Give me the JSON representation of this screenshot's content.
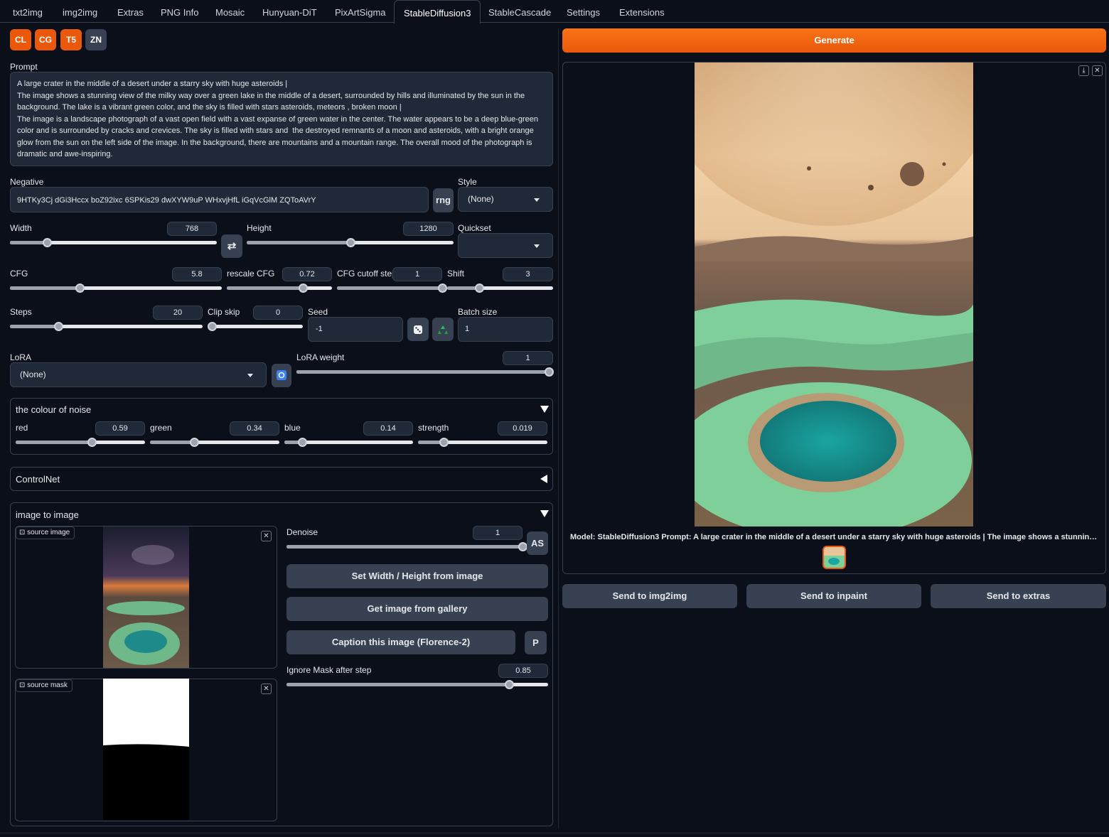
{
  "tabs": [
    "txt2img",
    "img2img",
    "Extras",
    "PNG Info",
    "Mosaic",
    "Hunyuan-DiT",
    "PixArtSigma",
    "StableDiffusion3",
    "StableCascade",
    "Settings",
    "Extensions"
  ],
  "toggles": [
    "CL",
    "CG",
    "T5",
    "ZN"
  ],
  "prompt": {
    "label": "Prompt",
    "value": "A large crater in the middle of a desert under a starry sky with huge asteroids |\nThe image shows a stunning view of the milky way over a green lake in the middle of a desert, surrounded by hills and illuminated by the sun in the\nbackground. The lake is a vibrant green color, and the sky is filled with stars asteroids, meteors , broken moon |\nThe image is a landscape photograph of a vast open field with a vast expanse of green water in the center. The water appears to be a deep blue-green\ncolor and is surrounded by cracks and crevices. The sky is filled with stars and  the destroyed remnants of a moon and asteroids, with a bright orange\nglow from the sun on the left side of the image. In the background, there are mountains and a mountain range. The overall mood of the photograph is\ndramatic and awe-inspiring."
  },
  "negative": {
    "label": "Negative",
    "value": "9HTKy3Cj dGi3Hccx boZ92ixc 6SPKis29 dwXYW9uP WHxvjHfL iGqVcGlM ZQToAVrY",
    "rng_label": "rng"
  },
  "style": {
    "label": "Style",
    "value": "(None)"
  },
  "width": {
    "label": "Width",
    "value": "768",
    "fraction": 0.18
  },
  "height": {
    "label": "Height",
    "value": "1280",
    "fraction": 0.5
  },
  "swap_icon": "⇄",
  "quickset": {
    "label": "Quickset",
    "value": ""
  },
  "cfg": {
    "label": "CFG",
    "value": "5.8",
    "fraction": 0.33
  },
  "rescale_cfg": {
    "label": "rescale CFG",
    "value": "0.72",
    "fraction": 0.72
  },
  "cfg_cutoff": {
    "label": "CFG cutoff step",
    "value": "1",
    "fraction": 1.0
  },
  "shift": {
    "label": "Shift",
    "value": "3",
    "fraction": 0.3
  },
  "steps": {
    "label": "Steps",
    "value": "20",
    "fraction": 0.25
  },
  "clip_skip": {
    "label": "Clip skip",
    "value": "0",
    "fraction": 0.0
  },
  "seed": {
    "label": "Seed",
    "value": "-1"
  },
  "batch_size": {
    "label": "Batch size",
    "value": "1"
  },
  "lora": {
    "label": "LoRA",
    "value": "(None)"
  },
  "lora_weight": {
    "label": "LoRA weight",
    "value": "1",
    "fraction": 1.0
  },
  "noise": {
    "title": "the colour of noise",
    "red": {
      "label": "red",
      "value": "0.59",
      "fraction": 0.59
    },
    "green": {
      "label": "green",
      "value": "0.34",
      "fraction": 0.34
    },
    "blue": {
      "label": "blue",
      "value": "0.14",
      "fraction": 0.14
    },
    "strength": {
      "label": "strength",
      "value": "0.019",
      "fraction": 0.2
    }
  },
  "controlnet": {
    "title": "ControlNet"
  },
  "i2i": {
    "title": "image to image",
    "source_image_label": "source image",
    "source_mask_label": "source mask",
    "denoise": {
      "label": "Denoise",
      "value": "1",
      "fraction": 1.0
    },
    "as_label": "AS",
    "set_wh": "Set Width / Height from image",
    "get_gallery": "Get image from gallery",
    "caption": "Caption this image (Florence-2)",
    "p_label": "P",
    "ignore_mask": {
      "label": "Ignore Mask after step",
      "value": "0.85",
      "fraction": 0.85
    }
  },
  "generate_label": "Generate",
  "output": {
    "caption": "Model: StableDiffusion3 Prompt: A large crater in the middle of a desert under a starry sky with huge asteroids | The image shows a stunning view ...",
    "download_icon": "⤓",
    "close_icon": "✕"
  },
  "send_buttons": [
    "Send to img2img",
    "Send to inpaint",
    "Send to extras"
  ],
  "colors": {
    "accent": "#ea580c",
    "bg": "#0b0f19",
    "panel": "#1f2937",
    "border": "#374151"
  }
}
